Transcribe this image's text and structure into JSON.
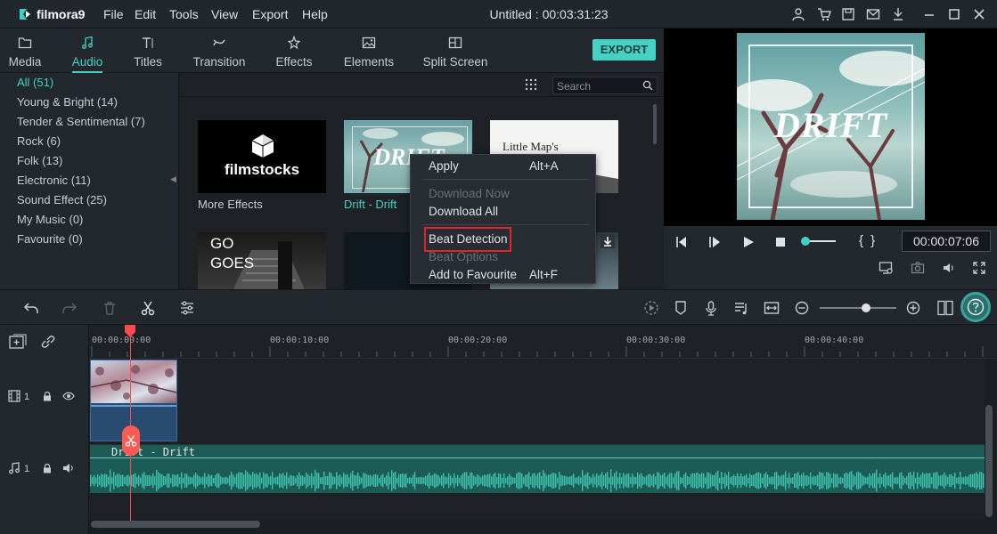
{
  "app": {
    "logo_text": "filmora9",
    "title": "Untitled : 00:03:31:23",
    "menu": [
      "File",
      "Edit",
      "Tools",
      "View",
      "Export",
      "Help"
    ]
  },
  "tabs": [
    {
      "label": "Media",
      "icon": "folder-icon"
    },
    {
      "label": "Audio",
      "icon": "music-note-icon",
      "active": true
    },
    {
      "label": "Titles",
      "icon": "text-icon"
    },
    {
      "label": "Transition",
      "icon": "transition-icon"
    },
    {
      "label": "Effects",
      "icon": "effects-icon"
    },
    {
      "label": "Elements",
      "icon": "image-icon"
    },
    {
      "label": "Split Screen",
      "icon": "split-screen-icon"
    }
  ],
  "export_label": "EXPORT",
  "sidebar": {
    "items": [
      {
        "label": "All (51)",
        "active": true
      },
      {
        "label": "Young & Bright (14)"
      },
      {
        "label": "Tender & Sentimental (7)"
      },
      {
        "label": "Rock (6)"
      },
      {
        "label": "Folk (13)"
      },
      {
        "label": "Electronic (11)"
      },
      {
        "label": "Sound Effect (25)"
      },
      {
        "label": "My Music (0)"
      },
      {
        "label": "Favourite (0)"
      }
    ]
  },
  "search": {
    "placeholder": "Search"
  },
  "media_items": [
    {
      "label": "More Effects",
      "thumb_text": "filmstocks"
    },
    {
      "label": "Drift - Drift",
      "thumb_text": "DRIFT"
    },
    {
      "label": "",
      "thumb_text": "Little Map's"
    },
    {
      "label": "",
      "thumb_text": "GO GOES"
    }
  ],
  "context_menu": {
    "items": [
      {
        "label": "Apply",
        "shortcut": "Alt+A",
        "disabled": false
      },
      {
        "label": "Download Now",
        "shortcut": "",
        "disabled": true
      },
      {
        "label": "Download All",
        "shortcut": "",
        "disabled": false
      },
      {
        "label": "Beat Detection",
        "shortcut": "",
        "disabled": false,
        "highlighted": true
      },
      {
        "label": "Beat Options",
        "shortcut": "",
        "disabled": true
      },
      {
        "label": "Add to Favourite",
        "shortcut": "Alt+F",
        "disabled": false
      }
    ]
  },
  "preview": {
    "title_text": "DRIFT",
    "timecode": "00:00:07:06",
    "mark_brackets": "{ }"
  },
  "timeline": {
    "ruler": [
      "00:00:00:00",
      "00:00:10:00",
      "00:00:20:00",
      "00:00:30:00",
      "00:00:40:00"
    ],
    "video_track_label": "1",
    "audio_track_label": "1",
    "audio_clip_name": "Drift - Drift",
    "zoom_level": 0.6
  },
  "colors": {
    "accent": "#42d0c5",
    "export_bg": "#47d1c4",
    "playhead": "#ff4b4b",
    "highlight_box": "#e0242c",
    "audio_wave": "#3fbfae"
  }
}
